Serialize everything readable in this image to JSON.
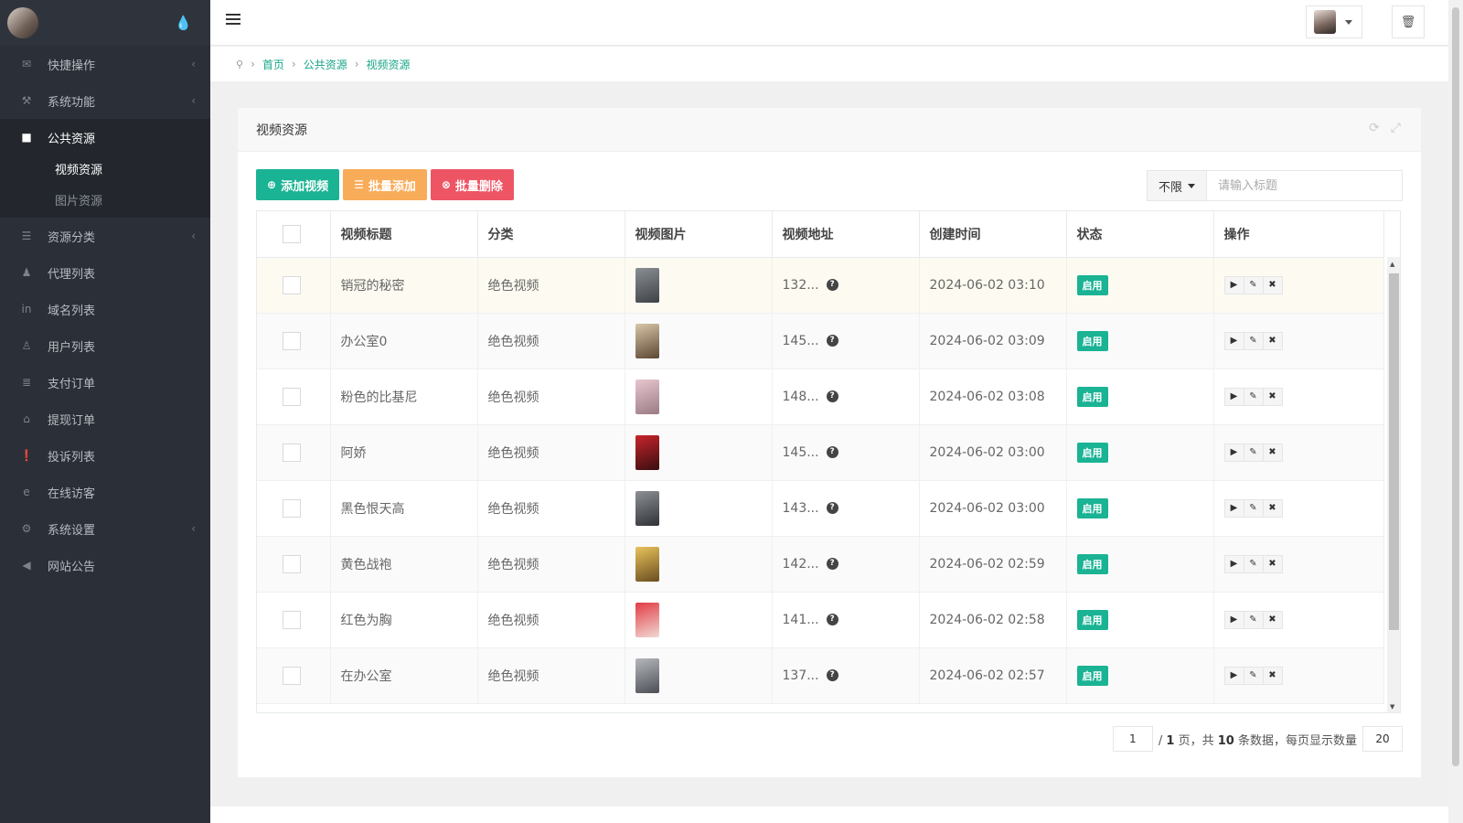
{
  "sidebar": {
    "drop_icon": "water-drop-icon",
    "menu_before": [
      {
        "icon": "✉",
        "label": "快捷操作",
        "arrow": "‹"
      },
      {
        "icon": "⚒",
        "label": "系统功能",
        "arrow": "‹"
      }
    ],
    "active": {
      "icon": "■",
      "label": "公共资源"
    },
    "submenu": [
      {
        "label": "视频资源"
      },
      {
        "label": "图片资源"
      }
    ],
    "menu_after": [
      {
        "icon": "☰",
        "label": "资源分类",
        "arrow": "‹"
      },
      {
        "icon": "♟",
        "label": "代理列表",
        "arrow": ""
      },
      {
        "icon": "in",
        "label": "域名列表",
        "arrow": ""
      },
      {
        "icon": "♙",
        "label": "用户列表",
        "arrow": ""
      },
      {
        "icon": "≣",
        "label": "支付订单",
        "arrow": ""
      },
      {
        "icon": "⌂",
        "label": "提现订单",
        "arrow": ""
      },
      {
        "icon": "❗",
        "label": "投诉列表",
        "arrow": ""
      },
      {
        "icon": "e",
        "label": "在线访客",
        "arrow": ""
      },
      {
        "icon": "⚙",
        "label": "系统设置",
        "arrow": "‹"
      },
      {
        "icon": "◀",
        "label": "网站公告",
        "arrow": ""
      }
    ]
  },
  "breadcrumb": {
    "items": [
      "首页",
      "公共资源",
      "视频资源"
    ]
  },
  "card": {
    "title": "视频资源",
    "buttons": {
      "add": "添加视频",
      "batch_add": "批量添加",
      "batch_delete": "批量删除"
    },
    "search": {
      "select_value": "不限",
      "placeholder": "请输入标题"
    }
  },
  "table": {
    "columns": [
      "视频标题",
      "分类",
      "视频图片",
      "视频地址",
      "创建时间",
      "状态",
      "操作"
    ],
    "rows": [
      {
        "title": "销冠的秘密",
        "category": "绝色视频",
        "url": "132...",
        "created": "2024-06-02 03:10",
        "status": "启用",
        "thumb": [
          "#8a8f93",
          "#3e4246"
        ]
      },
      {
        "title": "办公室0",
        "category": "绝色视频",
        "url": "145...",
        "created": "2024-06-02 03:09",
        "status": "启用",
        "thumb": [
          "#d9c7a8",
          "#5c4733"
        ]
      },
      {
        "title": "粉色的比基尼",
        "category": "绝色视频",
        "url": "148...",
        "created": "2024-06-02 03:08",
        "status": "启用",
        "thumb": [
          "#e9c6cf",
          "#9a7b84"
        ]
      },
      {
        "title": "阿娇",
        "category": "绝色视频",
        "url": "145...",
        "created": "2024-06-02 03:00",
        "status": "启用",
        "thumb": [
          "#c8242c",
          "#3a0e10"
        ]
      },
      {
        "title": "黑色恨天高",
        "category": "绝色视频",
        "url": "143...",
        "created": "2024-06-02 03:00",
        "status": "启用",
        "thumb": [
          "#8d9195",
          "#2f3236"
        ]
      },
      {
        "title": "黄色战袍",
        "category": "绝色视频",
        "url": "142...",
        "created": "2024-06-02 02:59",
        "status": "启用",
        "thumb": [
          "#e8c35a",
          "#6b4d20"
        ]
      },
      {
        "title": "红色为胸",
        "category": "绝色视频",
        "url": "141...",
        "created": "2024-06-02 02:58",
        "status": "启用",
        "thumb": [
          "#e23b45",
          "#f1d9d4"
        ]
      },
      {
        "title": "在办公室",
        "category": "绝色视频",
        "url": "137...",
        "created": "2024-06-02 02:57",
        "status": "启用",
        "thumb": [
          "#b6b8bd",
          "#4b4f55"
        ]
      }
    ]
  },
  "pager": {
    "current": "1",
    "total_pages": "1",
    "total_records": "10",
    "page_size": "20",
    "t1": "/",
    "t2": "页，共",
    "t3": "条数据，每页显示数量"
  },
  "colors": {
    "primary": "#1ab394",
    "warning": "#f8ac59",
    "danger": "#ed5565",
    "sidebar_bg": "#2b3038"
  }
}
